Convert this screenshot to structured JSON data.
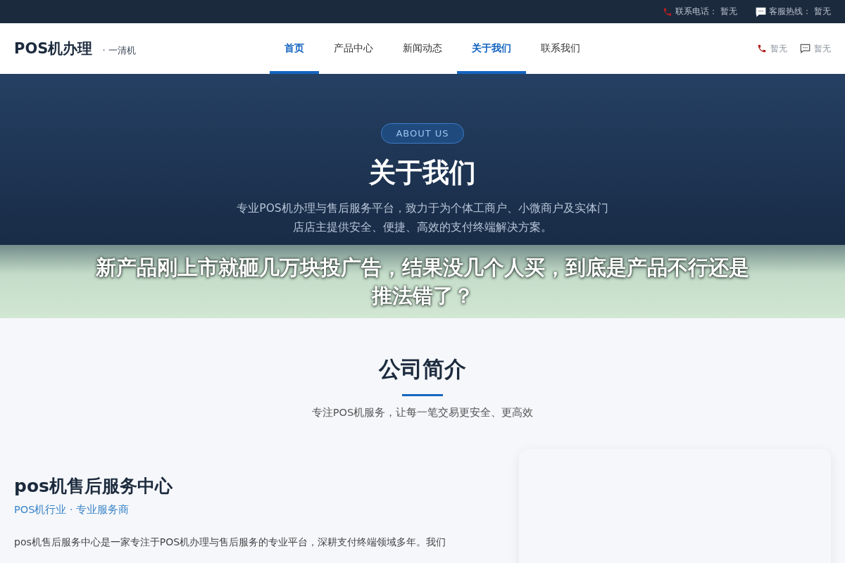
{
  "topbar": {
    "items": [
      {
        "kind": "phone",
        "label": "联系电话：",
        "value": "暂无"
      },
      {
        "kind": "chat",
        "label": "客服热线：",
        "value": "暂无"
      }
    ]
  },
  "header": {
    "logo": "POS机办理",
    "tagline": "· 一清机",
    "nav": [
      {
        "label": "首页",
        "selected": true
      },
      {
        "label": "产品中心",
        "selected": false
      },
      {
        "label": "新闻动态",
        "selected": false
      },
      {
        "label": "关于我们",
        "selected": true
      },
      {
        "label": "联系我们",
        "selected": false
      }
    ],
    "contacts": [
      {
        "kind": "phone",
        "value": "暂无"
      },
      {
        "kind": "chat",
        "value": "暂无"
      }
    ]
  },
  "hero": {
    "badge": "ABOUT US",
    "title": "关于我们",
    "lines": [
      "专业POS机办理与售后服务平台，致力于为个体工商户、小微商户及实体门",
      "店店主提供安全、便捷、高效的支付终端解决方案。"
    ]
  },
  "banner": {
    "lines": [
      "新产品刚上市就砸几万块投广告，结果没几个人买，到底是产品不行还是",
      "推法错了？"
    ]
  },
  "intro": {
    "title": "公司简介",
    "subtitle": "专注POS机服务，让每一笔交易更安全、更高效"
  },
  "company": {
    "name": "pos机售后服务中心",
    "tag": "POS机行业 · 专业服务商",
    "paragraph": "pos机售后服务中心是一家专注于POS机办理与售后服务的专业平台，深耕支付终端领域多年。我们"
  }
}
